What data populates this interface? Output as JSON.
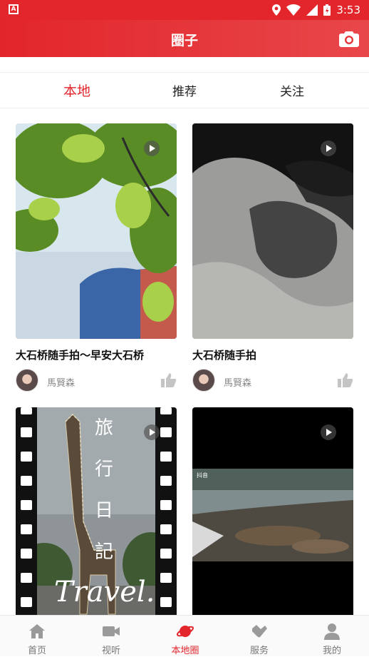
{
  "status_bar": {
    "time": "3:53",
    "app_icon_letter": "A"
  },
  "header": {
    "title": "圈子",
    "camera_icon": "camera-icon"
  },
  "tabs": [
    {
      "label": "本地",
      "active": true
    },
    {
      "label": "推荐",
      "active": false
    },
    {
      "label": "关注",
      "active": false
    }
  ],
  "posts": [
    {
      "title": "大石桥随手拍～早安大石桥",
      "author": "馬賢森"
    },
    {
      "title": "大石桥随手拍",
      "author": "馬賢森"
    },
    {
      "title": "",
      "author": ""
    },
    {
      "title": "",
      "author": ""
    }
  ],
  "thumb_text": {
    "travel_vertical": [
      "旅",
      "行",
      "日",
      "記"
    ],
    "travel_script": "Travel.",
    "douyin_watermark": "抖音"
  },
  "nav": [
    {
      "label": "首页",
      "icon": "home-icon",
      "active": false
    },
    {
      "label": "视听",
      "icon": "video-icon",
      "active": false
    },
    {
      "label": "本地圈",
      "icon": "planet-icon",
      "active": true
    },
    {
      "label": "服务",
      "icon": "handshake-icon",
      "active": false
    },
    {
      "label": "我的",
      "icon": "profile-icon",
      "active": false
    }
  ],
  "colors": {
    "brand_red": "#e3262b",
    "nav_inactive": "#777777",
    "author_gray": "#888888"
  }
}
